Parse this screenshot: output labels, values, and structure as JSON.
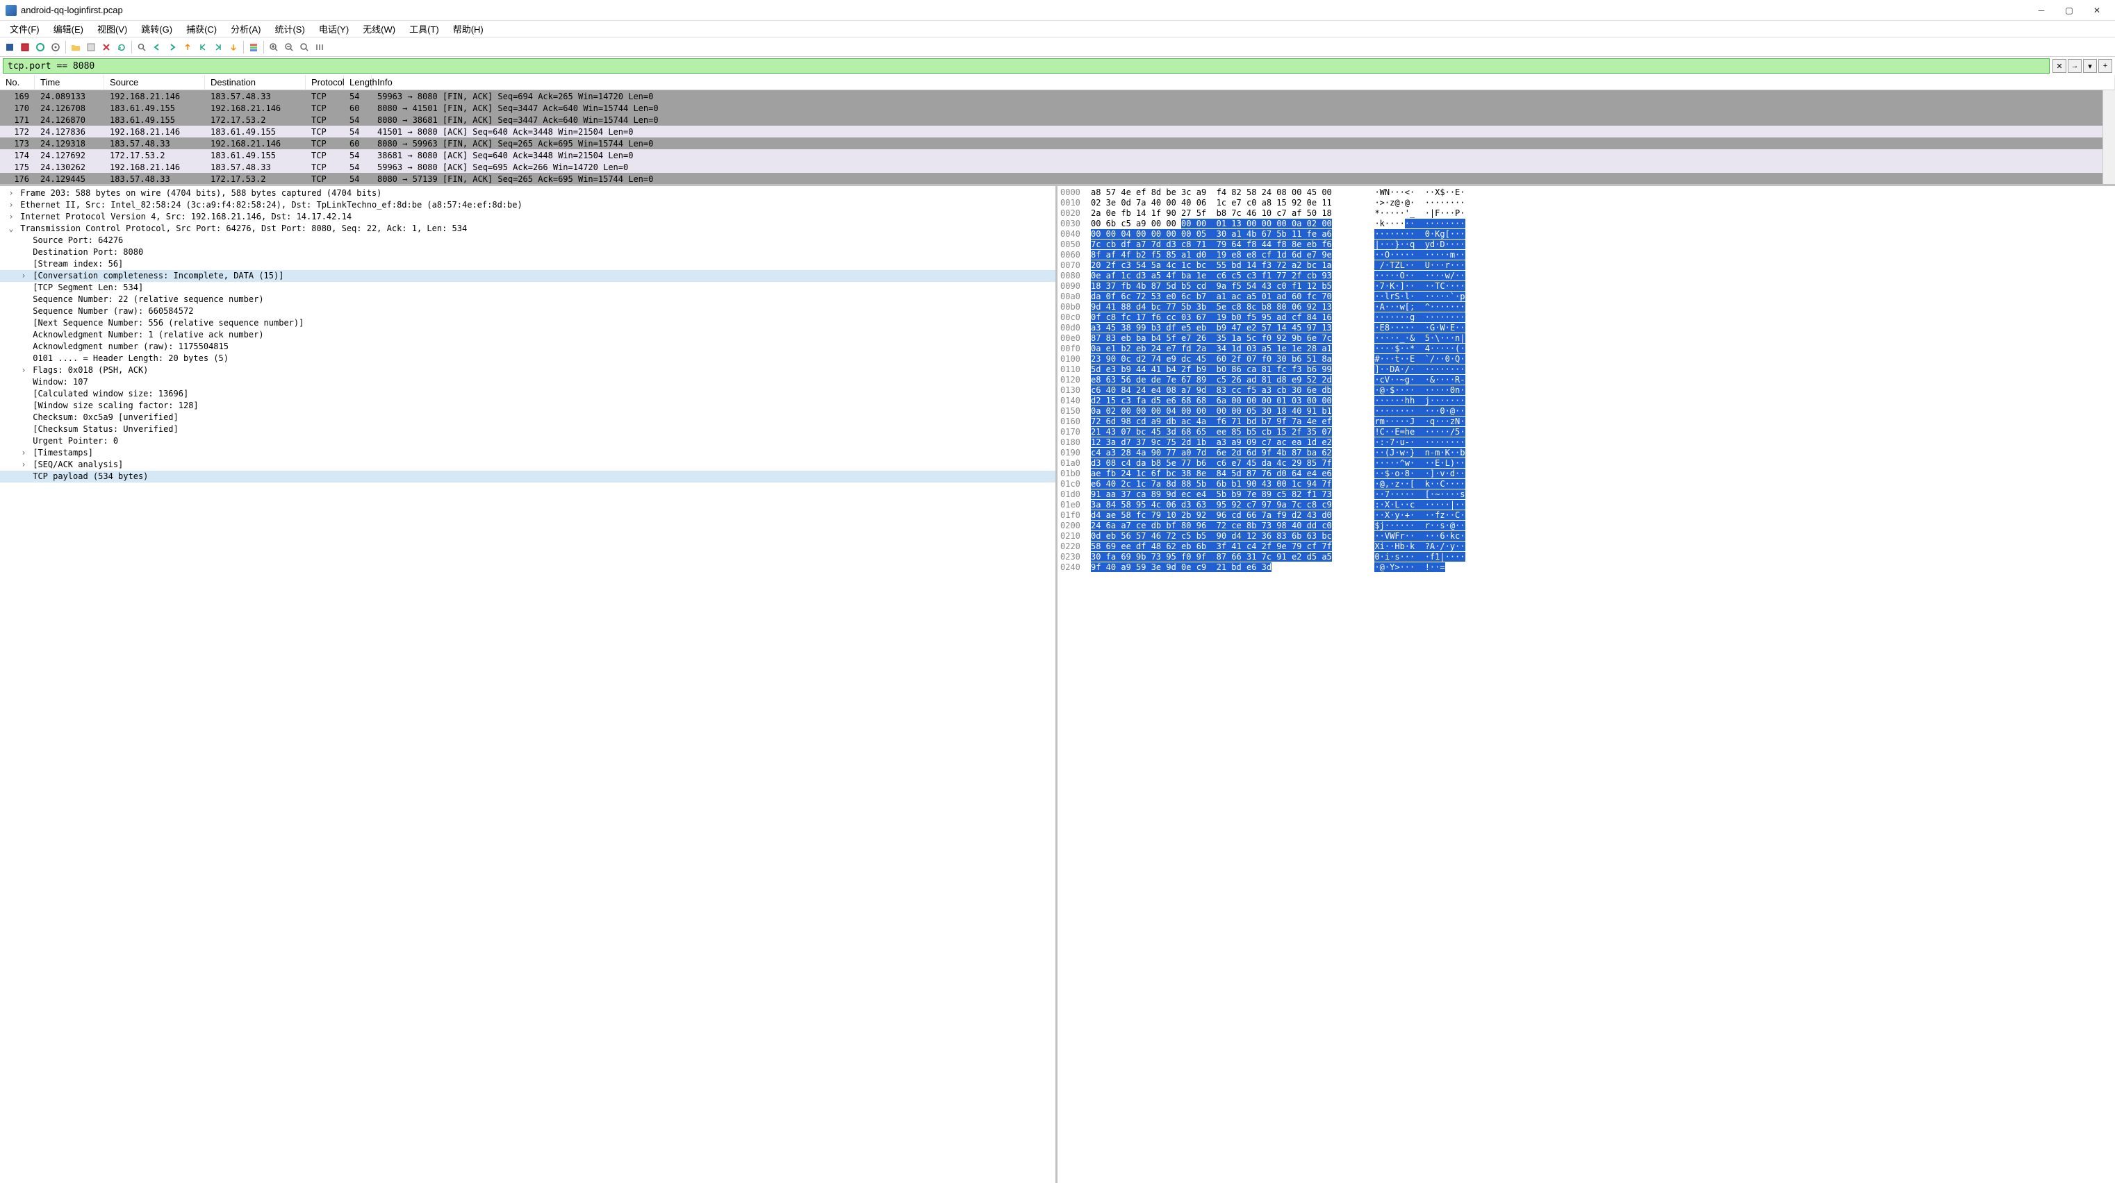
{
  "title": "android-qq-loginfirst.pcap",
  "menu": [
    "文件(F)",
    "编辑(E)",
    "视图(V)",
    "跳转(G)",
    "捕获(C)",
    "分析(A)",
    "统计(S)",
    "电话(Y)",
    "无线(W)",
    "工具(T)",
    "帮助(H)"
  ],
  "filter": "tcp.port == 8080",
  "columns": [
    "No.",
    "Time",
    "Source",
    "Destination",
    "Protocol",
    "Length",
    "Info"
  ],
  "packets": [
    {
      "no": "169",
      "time": "24.089133",
      "src": "192.168.21.146",
      "dst": "183.57.48.33",
      "proto": "TCP",
      "len": "54",
      "info": "59963 → 8080 [FIN, ACK] Seq=694 Ack=265 Win=14720 Len=0",
      "cls": "dark"
    },
    {
      "no": "170",
      "time": "24.126708",
      "src": "183.61.49.155",
      "dst": "192.168.21.146",
      "proto": "TCP",
      "len": "60",
      "info": "8080 → 41501 [FIN, ACK] Seq=3447 Ack=640 Win=15744 Len=0",
      "cls": "dark"
    },
    {
      "no": "171",
      "time": "24.126870",
      "src": "183.61.49.155",
      "dst": "172.17.53.2",
      "proto": "TCP",
      "len": "54",
      "info": "8080 → 38681 [FIN, ACK] Seq=3447 Ack=640 Win=15744 Len=0",
      "cls": "dark"
    },
    {
      "no": "172",
      "time": "24.127836",
      "src": "192.168.21.146",
      "dst": "183.61.49.155",
      "proto": "TCP",
      "len": "54",
      "info": "41501 → 8080 [ACK] Seq=640 Ack=3448 Win=21504 Len=0",
      "cls": "light"
    },
    {
      "no": "173",
      "time": "24.129318",
      "src": "183.57.48.33",
      "dst": "192.168.21.146",
      "proto": "TCP",
      "len": "60",
      "info": "8080 → 59963 [FIN, ACK] Seq=265 Ack=695 Win=15744 Len=0",
      "cls": "dark"
    },
    {
      "no": "174",
      "time": "24.127692",
      "src": "172.17.53.2",
      "dst": "183.61.49.155",
      "proto": "TCP",
      "len": "54",
      "info": "38681 → 8080 [ACK] Seq=640 Ack=3448 Win=21504 Len=0",
      "cls": "light"
    },
    {
      "no": "175",
      "time": "24.130262",
      "src": "192.168.21.146",
      "dst": "183.57.48.33",
      "proto": "TCP",
      "len": "54",
      "info": "59963 → 8080 [ACK] Seq=695 Ack=266 Win=14720 Len=0",
      "cls": "light"
    },
    {
      "no": "176",
      "time": "24.129445",
      "src": "183.57.48.33",
      "dst": "172.17.53.2",
      "proto": "TCP",
      "len": "54",
      "info": "8080 → 57139 [FIN, ACK] Seq=265 Ack=695 Win=15744 Len=0",
      "cls": "dark"
    }
  ],
  "details": [
    {
      "t": "Frame 203: 588 bytes on wire (4704 bits), 588 bytes captured (4704 bits)",
      "l": 0,
      "a": ">"
    },
    {
      "t": "Ethernet II, Src: Intel_82:58:24 (3c:a9:f4:82:58:24), Dst: TpLinkTechno_ef:8d:be (a8:57:4e:ef:8d:be)",
      "l": 0,
      "a": ">"
    },
    {
      "t": "Internet Protocol Version 4, Src: 192.168.21.146, Dst: 14.17.42.14",
      "l": 0,
      "a": ">"
    },
    {
      "t": "Transmission Control Protocol, Src Port: 64276, Dst Port: 8080, Seq: 22, Ack: 1, Len: 534",
      "l": 0,
      "a": "v"
    },
    {
      "t": "Source Port: 64276",
      "l": 1
    },
    {
      "t": "Destination Port: 8080",
      "l": 1
    },
    {
      "t": "[Stream index: 56]",
      "l": 1
    },
    {
      "t": "[Conversation completeness: Incomplete, DATA (15)]",
      "l": 1,
      "a": ">",
      "hl": true
    },
    {
      "t": "[TCP Segment Len: 534]",
      "l": 1
    },
    {
      "t": "Sequence Number: 22    (relative sequence number)",
      "l": 1
    },
    {
      "t": "Sequence Number (raw): 660584572",
      "l": 1
    },
    {
      "t": "[Next Sequence Number: 556    (relative sequence number)]",
      "l": 1
    },
    {
      "t": "Acknowledgment Number: 1    (relative ack number)",
      "l": 1
    },
    {
      "t": "Acknowledgment number (raw): 1175504815",
      "l": 1
    },
    {
      "t": "0101 .... = Header Length: 20 bytes (5)",
      "l": 1
    },
    {
      "t": "Flags: 0x018 (PSH, ACK)",
      "l": 1,
      "a": ">"
    },
    {
      "t": "Window: 107",
      "l": 1
    },
    {
      "t": "[Calculated window size: 13696]",
      "l": 1
    },
    {
      "t": "[Window size scaling factor: 128]",
      "l": 1
    },
    {
      "t": "Checksum: 0xc5a9 [unverified]",
      "l": 1
    },
    {
      "t": "[Checksum Status: Unverified]",
      "l": 1
    },
    {
      "t": "Urgent Pointer: 0",
      "l": 1
    },
    {
      "t": "[Timestamps]",
      "l": 1,
      "a": ">"
    },
    {
      "t": "[SEQ/ACK analysis]",
      "l": 1,
      "a": ">"
    },
    {
      "t": "TCP payload (534 bytes)",
      "l": 1,
      "hl": true
    }
  ],
  "bytes": [
    {
      "o": "0000",
      "h1": "a8 57 4e ef 8d be 3c a9",
      "h2": "f4 82 58 24 08 00 45 00",
      "a": "·WN···<·  ··X$··E·",
      "s": 0
    },
    {
      "o": "0010",
      "h1": "02 3e 0d 7a 40 00 40 06",
      "h2": "1c e7 c0 a8 15 92 0e 11",
      "a": "·>·z@·@·  ········",
      "s": 0
    },
    {
      "o": "0020",
      "h1": "2a 0e fb 14 1f 90 27 5f",
      "h2": "b8 7c 46 10 c7 af 50 18",
      "a": "*·····'_  ·|F···P·",
      "s": 0
    },
    {
      "o": "0030",
      "h1": "00 6b c5 a9 00 00 ",
      "h1b": "00 00",
      "h2": "01 13 00 00 00 0a 02 00",
      "a": "·k····",
      "ab": "··  ········",
      "s": 1
    },
    {
      "o": "0040",
      "h1": "00 00 04 00 00 00 00 05",
      "h2": "30 a1 4b 67 5b 11 fe a6",
      "a": "········  0·Kg[···",
      "s": 2
    },
    {
      "o": "0050",
      "h1": "7c cb df a7 7d d3 c8 71",
      "h2": "79 64 f8 44 f8 8e eb f6",
      "a": "|···}··q  yd·D····",
      "s": 2
    },
    {
      "o": "0060",
      "h1": "8f af 4f b2 f5 85 a1 d0",
      "h2": "19 e8 e8 cf 1d 6d e7 9e",
      "a": "··O·····  ·····m··",
      "s": 2
    },
    {
      "o": "0070",
      "h1": "20 2f c3 54 5a 4c 1c bc",
      "h2": "55 bd 14 f3 72 a2 bc 1a",
      "a": " /·TZL··  U···r···",
      "s": 2
    },
    {
      "o": "0080",
      "h1": "0e af 1c d3 a5 4f ba 1e",
      "h2": "c6 c5 c3 f1 77 2f cb 93",
      "a": "·····O··  ····w/··",
      "s": 2
    },
    {
      "o": "0090",
      "h1": "18 37 fb 4b 87 5d b5 cd",
      "h2": "9a f5 54 43 c0 f1 12 b5",
      "a": "·7·K·]··  ··TC····",
      "s": 2
    },
    {
      "o": "00a0",
      "h1": "da 0f 6c 72 53 e0 6c b7",
      "h2": "a1 ac a5 01 ad 60 fc 70",
      "a": "··lrS·l·  ·····`·p",
      "s": 2
    },
    {
      "o": "00b0",
      "h1": "9d 41 88 d4 bc 77 5b 3b",
      "h2": "5e c8 8c b8 80 06 92 13",
      "a": "·A···w[;  ^·······",
      "s": 2
    },
    {
      "o": "00c0",
      "h1": "0f c8 fc 17 f6 cc 03 67",
      "h2": "19 b0 f5 95 ad cf 84 16",
      "a": "·······g  ········",
      "s": 2
    },
    {
      "o": "00d0",
      "h1": "a3 45 38 99 b3 df e5 eb",
      "h2": "b9 47 e2 57 14 45 97 13",
      "a": "·E8·····  ·G·W·E··",
      "s": 2
    },
    {
      "o": "00e0",
      "h1": "87 83 eb ba b4 5f e7 26",
      "h2": "35 1a 5c f0 92 9b 6e 7c",
      "a": "·····_·&  5·\\···n|",
      "s": 2
    },
    {
      "o": "00f0",
      "h1": "0a e1 b2 eb 24 e7 fd 2a",
      "h2": "34 1d 03 a5 1e 1e 28 a1",
      "a": "····$··*  4·····(·",
      "s": 2
    },
    {
      "o": "0100",
      "h1": "23 90 0c d2 74 e9 dc 45",
      "h2": "60 2f 07 f0 30 b6 51 8a",
      "a": "#···t··E  `/··0·Q·",
      "s": 2
    },
    {
      "o": "0110",
      "h1": "5d e3 b9 44 41 b4 2f b9",
      "h2": "b0 86 ca 81 fc f3 b6 99",
      "a": "]··DA·/·  ········",
      "s": 2
    },
    {
      "o": "0120",
      "h1": "e8 63 56 de de 7e 67 89",
      "h2": "c5 26 ad 81 d8 e9 52 2d",
      "a": "·cV··~g·  ·&····R-",
      "s": 2
    },
    {
      "o": "0130",
      "h1": "c6 40 84 24 e4 08 a7 9d",
      "h2": "83 cc f5 a3 cb 30 6e db",
      "a": "·@·$····  ·····0n·",
      "s": 2
    },
    {
      "o": "0140",
      "h1": "d2 15 c3 fa d5 e6 68 68",
      "h2": "6a 00 00 00 01 03 00 00",
      "a": "······hh  j·······",
      "s": 2
    },
    {
      "o": "0150",
      "h1": "0a 02 00 00 00 04 00 00",
      "h2": "00 00 05 30 18 40 91 b1",
      "a": "········  ···0·@··",
      "s": 2
    },
    {
      "o": "0160",
      "h1": "72 6d 98 cd a9 db ac 4a",
      "h2": "f6 71 bd b7 9f 7a 4e ef",
      "a": "rm·····J  ·q···zN·",
      "s": 2
    },
    {
      "o": "0170",
      "h1": "21 43 07 bc 45 3d 68 65",
      "h2": "ee 85 b5 cb 15 2f 35 07",
      "a": "!C··E=he  ·····/5·",
      "s": 2
    },
    {
      "o": "0180",
      "h1": "12 3a d7 37 9c 75 2d 1b",
      "h2": "a3 a9 09 c7 ac ea 1d e2",
      "a": "·:·7·u-·  ········",
      "s": 2
    },
    {
      "o": "0190",
      "h1": "c4 a3 28 4a 90 77 a0 7d",
      "h2": "6e 2d 6d 9f 4b 87 ba 62",
      "a": "··(J·w·}  n-m·K··b",
      "s": 2
    },
    {
      "o": "01a0",
      "h1": "d3 08 c4 da b8 5e 77 b6",
      "h2": "c6 e7 45 da 4c 29 85 7f",
      "a": "·····^w·  ··E·L)··",
      "s": 2
    },
    {
      "o": "01b0",
      "h1": "ae fb 24 1c 6f bc 38 8e",
      "h2": "84 5d 87 76 d0 64 e4 e6",
      "a": "··$·o·8·  ·]·v·d··",
      "s": 2
    },
    {
      "o": "01c0",
      "h1": "e6 40 2c 1c 7a 8d 88 5b",
      "h2": "6b b1 90 43 00 1c 94 7f",
      "a": "·@,·z··[  k··C····",
      "s": 2
    },
    {
      "o": "01d0",
      "h1": "91 aa 37 ca 89 9d ec e4",
      "h2": "5b b9 7e 89 c5 82 f1 73",
      "a": "··7·····  [·~····s",
      "s": 2
    },
    {
      "o": "01e0",
      "h1": "3a 84 58 95 4c 06 d3 63",
      "h2": "95 92 c7 97 9a 7c c8 c9",
      "a": ":·X·L··c  ·····|··",
      "s": 2
    },
    {
      "o": "01f0",
      "h1": "d4 ae 58 fc 79 10 2b 92",
      "h2": "96 cd 66 7a f9 d2 43 d0",
      "a": "··X·y·+·  ··fz··C·",
      "s": 2
    },
    {
      "o": "0200",
      "h1": "24 6a a7 ce db bf 80 96",
      "h2": "72 ce 8b 73 98 40 dd c0",
      "a": "$j······  r··s·@··",
      "s": 2
    },
    {
      "o": "0210",
      "h1": "0d eb 56 57 46 72 c5 b5",
      "h2": "90 d4 12 36 83 6b 63 bc",
      "a": "··VWFr··  ···6·kc·",
      "s": 2
    },
    {
      "o": "0220",
      "h1": "58 69 ee df 48 62 eb 6b",
      "h2": "3f 41 c4 2f 9e 79 cf 7f",
      "a": "Xi··Hb·k  ?A·/·y··",
      "s": 2
    },
    {
      "o": "0230",
      "h1": "30 fa 69 9b 73 95 f0 9f",
      "h2": "87 66 31 7c 91 e2 d5 a5",
      "a": "0·i·s···  ·f1|····",
      "s": 2
    },
    {
      "o": "0240",
      "h1": "9f 40 a9 59 3e 9d 0e c9",
      "h2": "21 bd e6 3d",
      "a": "·@·Y>···  !··=",
      "s": 2
    }
  ]
}
